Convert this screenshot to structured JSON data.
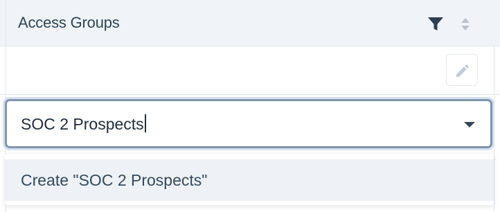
{
  "header": {
    "title": "Access Groups",
    "filter_icon": "filter-icon",
    "sort_icon": "sort-icon"
  },
  "edit_button": {
    "icon": "pencil-icon"
  },
  "select": {
    "value": "SOC 2 Prospects",
    "dropdown_icon": "chevron-down-icon"
  },
  "menu": {
    "options": [
      {
        "label": "Create \"SOC 2 Prospects\""
      }
    ]
  },
  "colors": {
    "header_bg": "#f0f4f8",
    "border": "#dde5ec",
    "focus_border": "#7f95ab",
    "option_highlight": "#eef2f6",
    "text": "#2c4357"
  }
}
